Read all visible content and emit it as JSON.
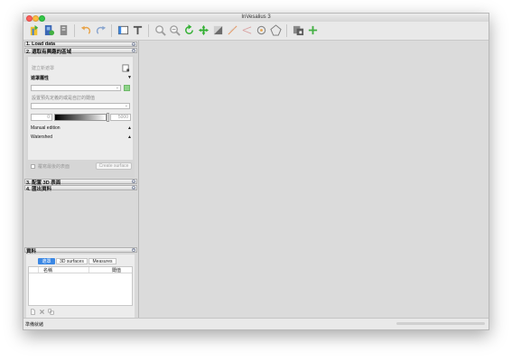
{
  "window": {
    "title": "InVesalius 3"
  },
  "toolbar": {
    "icons": [
      "import-icon",
      "dicom-icon",
      "report-icon",
      "undo-icon",
      "redo-icon",
      "layout-icon",
      "text-icon",
      "zoom-in-icon",
      "zoom-out-icon",
      "rotate-icon",
      "pan-icon",
      "contrast-icon",
      "measure-linear-icon",
      "measure-angle-icon",
      "measure-circle-icon",
      "polygon-icon",
      "slice-icon",
      "add-icon"
    ]
  },
  "sections": {
    "load_data": "1. Load data",
    "select_region": "2. 選取有興趣的區域",
    "configure_3d": "3. 配置 3D 表面",
    "export_data": "4. 匯出資料",
    "data": "資料"
  },
  "mask": {
    "create_label": "建立新遮罩",
    "properties_label": "遮罩屬性",
    "threshold_label": "設置預先定義的或是自訂的閾值",
    "threshold_min": "0",
    "threshold_max": "5000",
    "manual_edition": "Manual edition",
    "watershed": "Watershed",
    "overwrite_label": "覆寫最後的表面",
    "create_surface": "Create surface"
  },
  "data_panel": {
    "tabs": [
      "遮罩",
      "3D surfaces",
      "Measures"
    ],
    "columns": [
      "名稱",
      "閾值"
    ]
  },
  "status": {
    "text": "準備就緒"
  },
  "colors": {
    "accent": "#3a87e4",
    "green": "#33b033"
  }
}
